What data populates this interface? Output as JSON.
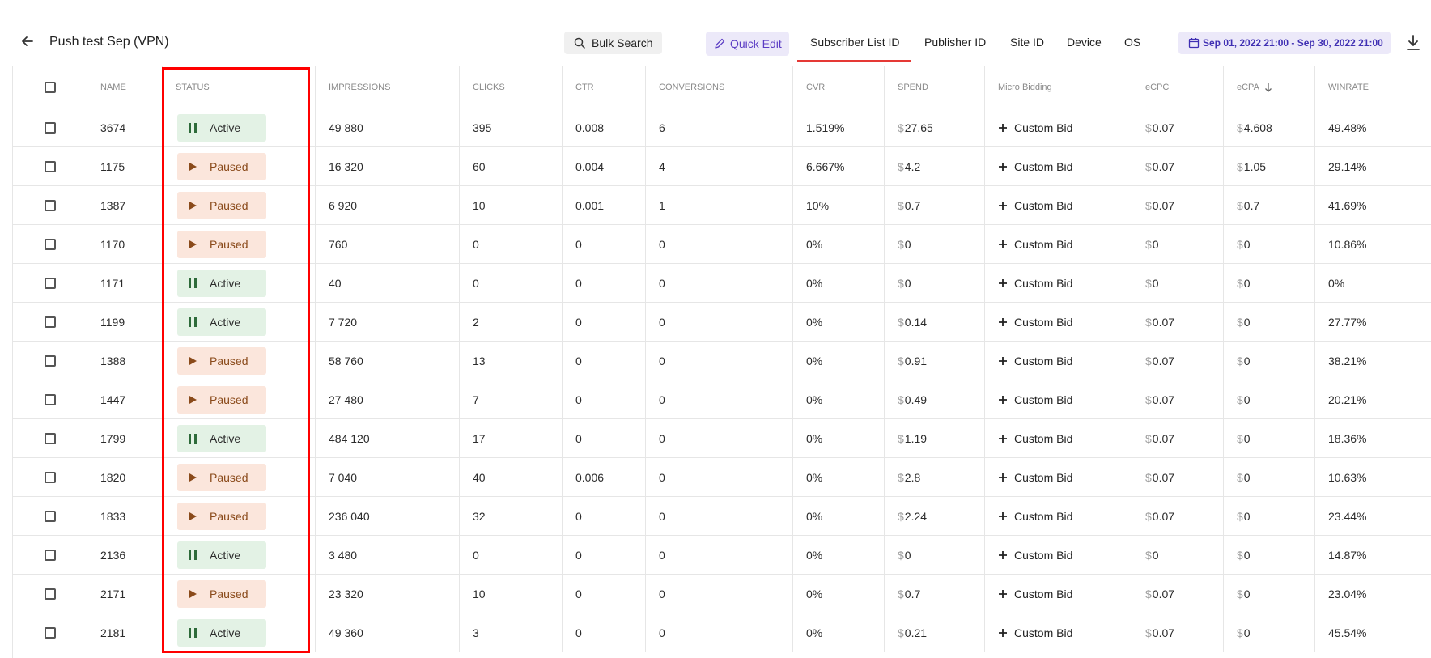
{
  "header": {
    "title": "Push test Sep (VPN)",
    "bulk_search_label": "Bulk Search",
    "quick_edit_label": "Quick Edit",
    "date_range": "Sep 01, 2022 21:00 - Sep 30, 2022 21:00"
  },
  "tabs": [
    {
      "label": "Subscriber List ID",
      "active": true
    },
    {
      "label": "Publisher ID"
    },
    {
      "label": "Site ID"
    },
    {
      "label": "Device"
    },
    {
      "label": "OS"
    }
  ],
  "columns": [
    "NAME",
    "STATUS",
    "IMPRESSIONS",
    "CLICKS",
    "CTR",
    "CONVERSIONS",
    "CVR",
    "SPEND",
    "Micro Bidding",
    "eCPC",
    "eCPA",
    "WINRATE"
  ],
  "currency_symbol": "$",
  "custom_bid_label": "Custom Bid",
  "status_colors": {
    "active": "#e3f2e5",
    "paused": "#fbe6dc"
  },
  "rows": [
    {
      "name": "3674",
      "status": "Active",
      "impressions": "49 880",
      "clicks": "395",
      "ctr": "0.008",
      "conversions": "6",
      "cvr": "1.519%",
      "spend": "27.65",
      "ecpc": "0.07",
      "ecpa": "4.608",
      "winrate": "49.48%"
    },
    {
      "name": "1175",
      "status": "Paused",
      "impressions": "16 320",
      "clicks": "60",
      "ctr": "0.004",
      "conversions": "4",
      "cvr": "6.667%",
      "spend": "4.2",
      "ecpc": "0.07",
      "ecpa": "1.05",
      "winrate": "29.14%"
    },
    {
      "name": "1387",
      "status": "Paused",
      "impressions": "6 920",
      "clicks": "10",
      "ctr": "0.001",
      "conversions": "1",
      "cvr": "10%",
      "spend": "0.7",
      "ecpc": "0.07",
      "ecpa": "0.7",
      "winrate": "41.69%"
    },
    {
      "name": "1170",
      "status": "Paused",
      "impressions": "760",
      "clicks": "0",
      "ctr": "0",
      "conversions": "0",
      "cvr": "0%",
      "spend": "0",
      "ecpc": "0",
      "ecpa": "0",
      "winrate": "10.86%"
    },
    {
      "name": "1171",
      "status": "Active",
      "impressions": "40",
      "clicks": "0",
      "ctr": "0",
      "conversions": "0",
      "cvr": "0%",
      "spend": "0",
      "ecpc": "0",
      "ecpa": "0",
      "winrate": "0%"
    },
    {
      "name": "1199",
      "status": "Active",
      "impressions": "7 720",
      "clicks": "2",
      "ctr": "0",
      "conversions": "0",
      "cvr": "0%",
      "spend": "0.14",
      "ecpc": "0.07",
      "ecpa": "0",
      "winrate": "27.77%"
    },
    {
      "name": "1388",
      "status": "Paused",
      "impressions": "58 760",
      "clicks": "13",
      "ctr": "0",
      "conversions": "0",
      "cvr": "0%",
      "spend": "0.91",
      "ecpc": "0.07",
      "ecpa": "0",
      "winrate": "38.21%"
    },
    {
      "name": "1447",
      "status": "Paused",
      "impressions": "27 480",
      "clicks": "7",
      "ctr": "0",
      "conversions": "0",
      "cvr": "0%",
      "spend": "0.49",
      "ecpc": "0.07",
      "ecpa": "0",
      "winrate": "20.21%"
    },
    {
      "name": "1799",
      "status": "Active",
      "impressions": "484 120",
      "clicks": "17",
      "ctr": "0",
      "conversions": "0",
      "cvr": "0%",
      "spend": "1.19",
      "ecpc": "0.07",
      "ecpa": "0",
      "winrate": "18.36%"
    },
    {
      "name": "1820",
      "status": "Paused",
      "impressions": "7 040",
      "clicks": "40",
      "ctr": "0.006",
      "conversions": "0",
      "cvr": "0%",
      "spend": "2.8",
      "ecpc": "0.07",
      "ecpa": "0",
      "winrate": "10.63%"
    },
    {
      "name": "1833",
      "status": "Paused",
      "impressions": "236 040",
      "clicks": "32",
      "ctr": "0",
      "conversions": "0",
      "cvr": "0%",
      "spend": "2.24",
      "ecpc": "0.07",
      "ecpa": "0",
      "winrate": "23.44%"
    },
    {
      "name": "2136",
      "status": "Active",
      "impressions": "3 480",
      "clicks": "0",
      "ctr": "0",
      "conversions": "0",
      "cvr": "0%",
      "spend": "0",
      "ecpc": "0",
      "ecpa": "0",
      "winrate": "14.87%"
    },
    {
      "name": "2171",
      "status": "Paused",
      "impressions": "23 320",
      "clicks": "10",
      "ctr": "0",
      "conversions": "0",
      "cvr": "0%",
      "spend": "0.7",
      "ecpc": "0.07",
      "ecpa": "0",
      "winrate": "23.04%"
    },
    {
      "name": "2181",
      "status": "Active",
      "impressions": "49 360",
      "clicks": "3",
      "ctr": "0",
      "conversions": "0",
      "cvr": "0%",
      "spend": "0.21",
      "ecpc": "0.07",
      "ecpa": "0",
      "winrate": "45.54%"
    }
  ]
}
